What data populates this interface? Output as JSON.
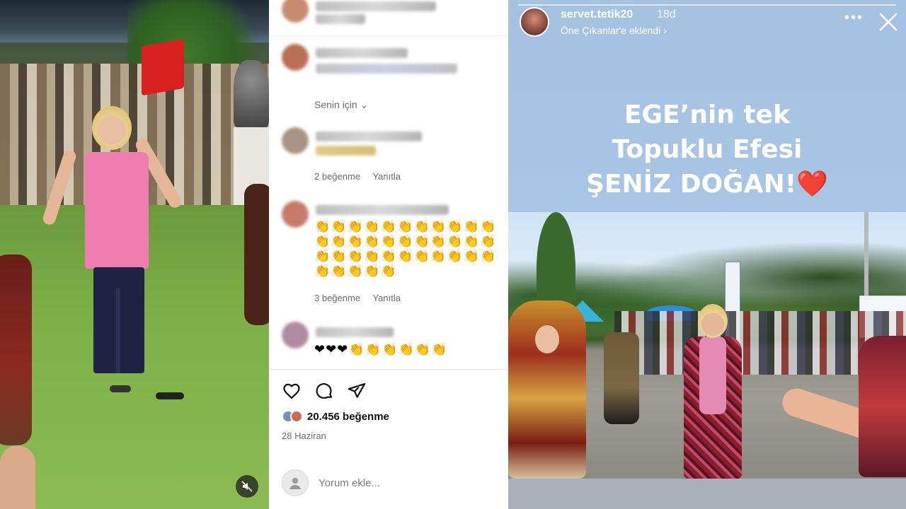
{
  "feed": {
    "senin_icin_label": "Senin için",
    "comments": [
      {
        "emojis": "",
        "likes": "",
        "reply": ""
      },
      {
        "emojis": "",
        "likes": "",
        "reply": ""
      },
      {
        "emojis": "",
        "likes": "2 beğenme",
        "reply": "Yanıtla"
      },
      {
        "emojis": "👏👏👏👏👏👏👏👏👏👏👏\n👏👏👏👏👏👏👏👏👏👏👏\n👏👏👏👏👏👏👏👏👏👏👏\n👏👏👏👏👏",
        "likes": "3 beğenme",
        "reply": "Yanıtla"
      },
      {
        "emojis": "❤❤❤👏👏👏👏👏👏",
        "likes": "",
        "reply": ""
      }
    ],
    "icons": [
      "heart-outline-icon",
      "comment-bubble-icon",
      "share-paper-plane-icon"
    ],
    "likes_count": "20.456 beğenme",
    "date": "28 Haziran",
    "comment_placeholder": "Yorum ekle..."
  },
  "story": {
    "username": "servet.tetik20",
    "time": "18d",
    "subtitle": "Öne Çıkanlar'e eklendi ›",
    "headline_line1": "EGE’nin tek",
    "headline_line2": "Topuklu Efesi",
    "headline_line3": "ŞENİZ DOĞAN!",
    "headline_emoji": "❤️",
    "more_label": "•••"
  },
  "colors": {
    "instagram_text": "#111111",
    "muted_text": "#6b6b6b",
    "story_bg": "#a9c5e4",
    "heart_red": "#e52222"
  }
}
